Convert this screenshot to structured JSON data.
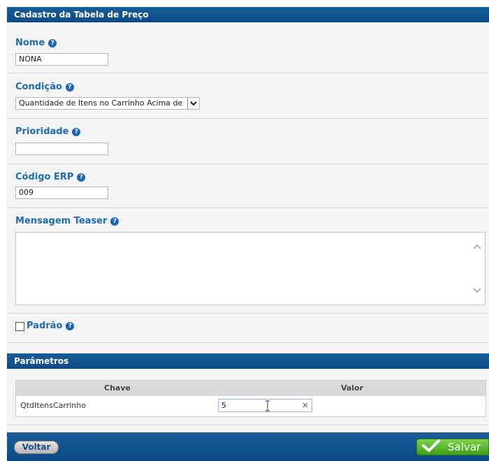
{
  "form": {
    "title": "Cadastro da Tabela de Preço",
    "help_glyph": "?",
    "nome": {
      "label": "Nome",
      "value": "NONA"
    },
    "condicao": {
      "label": "Condição",
      "value": "Quantidade de Itens no Carrinho Acima de"
    },
    "prioridade": {
      "label": "Prioridade",
      "value": ""
    },
    "codigo_erp": {
      "label": "Código ERP",
      "value": "009"
    },
    "mensagem_teaser": {
      "label": "Mensagem Teaser",
      "value": ""
    },
    "padrao": {
      "label": "Padrão",
      "checked": false
    }
  },
  "parametros": {
    "title": "Parâmetros",
    "columns": [
      "Chave",
      "Valor"
    ],
    "rows": [
      {
        "chave": "QtdItensCarrinho",
        "valor": "5"
      }
    ],
    "clear_glyph": "×"
  },
  "footer": {
    "back_label": "Voltar",
    "save_label": "Salvar"
  },
  "colors": {
    "header_blue": "#0c4a85",
    "label_blue": "#1f6bb0",
    "save_green": "#3e9e18"
  }
}
